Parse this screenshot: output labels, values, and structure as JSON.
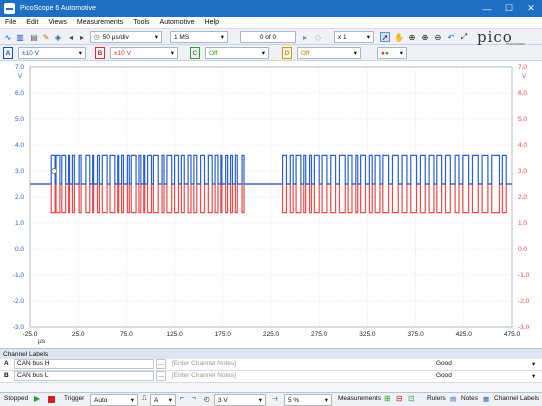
{
  "window": {
    "title": "PicoScope 6 Automotive",
    "buttons": [
      "—",
      "☐",
      "✕"
    ]
  },
  "menu": [
    "File",
    "Edit",
    "Views",
    "Measurements",
    "Tools",
    "Automotive",
    "Help"
  ],
  "toolbar1": {
    "timebase": "50 µs/div",
    "samples": "1 MS",
    "buffer": "0 of 0",
    "zoom": "x 1",
    "brand": "pico",
    "brand_sub": "Technology"
  },
  "toolbar2": {
    "channels": [
      {
        "id": "A",
        "range": "±10 V",
        "color": "#1f4fbf"
      },
      {
        "id": "B",
        "range": "±10 V",
        "color": "#e03030"
      },
      {
        "id": "C",
        "range": "Off",
        "color": "#3a9a3a"
      },
      {
        "id": "D",
        "range": "Off",
        "color": "#d8a000"
      }
    ]
  },
  "plot": {
    "left_axis_unit": "V",
    "right_axis_unit": "V",
    "x_unit": "µs",
    "colors": {
      "a": "#2a5fd0",
      "b": "#ea4a4a"
    }
  },
  "chart_data": {
    "type": "line",
    "xlim": [
      -25,
      475
    ],
    "ylim": [
      -3,
      7
    ],
    "x_ticks": [
      -25.0,
      25.0,
      75.0,
      125.0,
      175.0,
      225.0,
      275.0,
      325.0,
      375.0,
      425.0,
      475.0
    ],
    "y_ticks": [
      -3.0,
      -2.0,
      -1.0,
      0.0,
      1.0,
      2.0,
      3.0,
      4.0,
      5.0,
      6.0,
      7.0
    ],
    "series": [
      {
        "name": "CAN bus H",
        "recessive": 2.5,
        "dominant": 3.6
      },
      {
        "name": "CAN bus L",
        "recessive": 2.5,
        "dominant": 1.4
      }
    ],
    "dominant_bits": [
      [
        -3,
        1
      ],
      [
        2,
        6
      ],
      [
        8,
        12
      ],
      [
        15,
        16
      ],
      [
        19,
        21
      ],
      [
        26,
        28
      ],
      [
        33,
        37
      ],
      [
        40,
        41
      ],
      [
        45,
        47
      ],
      [
        50,
        55
      ],
      [
        58,
        63
      ],
      [
        66,
        67
      ],
      [
        70,
        72
      ],
      [
        76,
        78
      ],
      [
        80,
        85
      ],
      [
        88,
        90
      ],
      [
        93,
        94
      ],
      [
        97,
        101
      ],
      [
        103,
        108
      ],
      [
        112,
        114
      ],
      [
        117,
        122
      ],
      [
        125,
        129
      ],
      [
        132,
        135
      ],
      [
        139,
        142
      ],
      [
        145,
        148
      ],
      [
        152,
        156
      ],
      [
        160,
        164
      ],
      [
        167,
        170
      ],
      [
        173,
        174
      ],
      [
        178,
        180
      ],
      [
        183,
        185
      ],
      [
        188,
        190
      ],
      [
        195,
        197
      ],
      [
        237,
        241
      ],
      [
        245,
        248
      ],
      [
        251,
        256
      ],
      [
        259,
        261
      ],
      [
        265,
        267
      ],
      [
        270,
        275
      ],
      [
        278,
        283
      ],
      [
        287,
        292
      ],
      [
        296,
        302
      ],
      [
        305,
        309
      ],
      [
        313,
        315
      ],
      [
        318,
        323
      ],
      [
        327,
        330
      ],
      [
        333,
        338
      ],
      [
        341,
        347
      ],
      [
        351,
        357
      ],
      [
        361,
        366
      ],
      [
        370,
        376
      ],
      [
        380,
        385
      ],
      [
        389,
        394
      ],
      [
        397,
        402
      ],
      [
        406,
        411
      ],
      [
        416,
        420
      ],
      [
        424,
        430
      ],
      [
        434,
        440
      ],
      [
        444,
        450
      ],
      [
        454,
        462
      ],
      [
        465,
        469
      ]
    ]
  },
  "channel_labels": {
    "title": "Channel Labels",
    "rows": [
      {
        "ch": "A",
        "label": "CAN bus H",
        "notes_placeholder": "[Enter Channel Notes]",
        "status": "Good"
      },
      {
        "ch": "B",
        "label": "CAN bus L",
        "notes_placeholder": "[Enter Channel Notes]",
        "status": "Good"
      }
    ]
  },
  "status_bar": {
    "run_state": "Stopped",
    "trigger_label": "Trigger",
    "trigger_mode": "Auto",
    "trigger_channel": "A",
    "trigger_level": "3 V",
    "pretrigger": "5 %",
    "measurements": "Measurements",
    "rulers": "Rulers",
    "notes": "Notes",
    "channel_labels": "Channel Labels"
  }
}
